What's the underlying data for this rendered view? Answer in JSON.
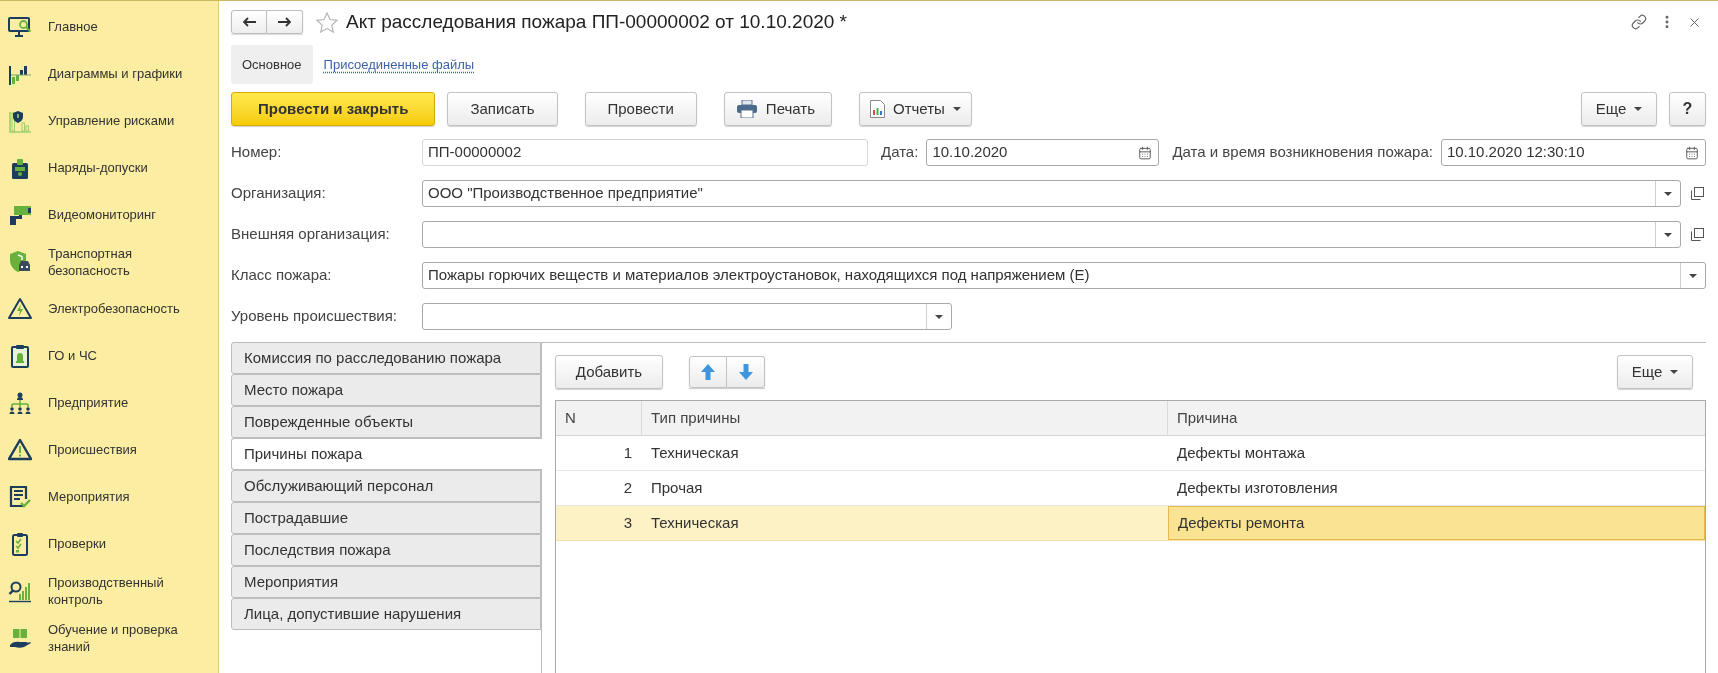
{
  "sidebar": {
    "items": [
      {
        "label": "Главное"
      },
      {
        "label": "Диаграммы и графики"
      },
      {
        "label": "Управление рисками"
      },
      {
        "label": "Наряды-допуски"
      },
      {
        "label": "Видеомониторинг"
      },
      {
        "label": "Транспортная безопасность"
      },
      {
        "label": "Электробезопасность"
      },
      {
        "label": "ГО и ЧС"
      },
      {
        "label": "Предприятие"
      },
      {
        "label": "Происшествия"
      },
      {
        "label": "Мероприятия"
      },
      {
        "label": "Проверки"
      },
      {
        "label": "Производственный контроль"
      },
      {
        "label": "Обучение и проверка знаний"
      }
    ]
  },
  "window": {
    "title": "Акт расследования пожара ПП-00000002 от 10.10.2020 *",
    "favorite": false
  },
  "form_tabs": [
    {
      "label": "Основное",
      "selected": true
    },
    {
      "label": "Присоединенные файлы",
      "selected": false
    }
  ],
  "command_bar": {
    "buttons": [
      {
        "label": "Провести и закрыть",
        "kind": "primary"
      },
      {
        "label": "Записать",
        "kind": "plain"
      },
      {
        "label": "Провести",
        "kind": "plain"
      },
      {
        "label": "Печать",
        "kind": "print"
      },
      {
        "label": "Отчеты",
        "kind": "reports"
      }
    ],
    "more": "Еще",
    "help": "?"
  },
  "fields": {
    "number": {
      "label": "Номер:",
      "value": "ПП-00000002"
    },
    "date": {
      "label": "Дата:",
      "value": "10.10.2020"
    },
    "fire_datetime": {
      "label": "Дата и время возникновения пожара:",
      "value": "10.10.2020 12:30:10"
    },
    "organization": {
      "label": "Организация:",
      "value": "ООО \"Производственное предприятие\""
    },
    "external_organization": {
      "label": "Внешняя организация:"
    },
    "fire_class": {
      "label": "Класс пожара:",
      "value": "Пожары горючих веществ и материалов электроустановок, находящихся под напряжением (E)"
    },
    "incident_level": {
      "label": "Уровень происшествия:"
    }
  },
  "sections": [
    {
      "label": "Комиссия по расследованию пожара",
      "selected": false
    },
    {
      "label": "Место пожара",
      "selected": false
    },
    {
      "label": "Поврежденные объекты",
      "selected": false
    },
    {
      "label": "Причины пожара",
      "selected": true
    },
    {
      "label": "Обслуживающий персонал",
      "selected": false
    },
    {
      "label": "Пострадавшие",
      "selected": false
    },
    {
      "label": "Последствия пожара",
      "selected": false
    },
    {
      "label": "Мероприятия",
      "selected": false
    },
    {
      "label": "Лица, допустившие нарушения",
      "selected": false
    }
  ],
  "table_toolbar": {
    "add": "Добавить",
    "more": "Еще"
  },
  "table": {
    "columns": [
      "N",
      "Тип причины",
      "Причина"
    ],
    "rows": [
      {
        "selected": false,
        "cells": [
          {
            "text": "1",
            "focused": false
          },
          {
            "text": "Техническая",
            "focused": false
          },
          {
            "text": "Дефекты монтажа",
            "focused": false
          }
        ]
      },
      {
        "selected": false,
        "cells": [
          {
            "text": "2",
            "focused": false
          },
          {
            "text": "Прочая",
            "focused": false
          },
          {
            "text": "Дефекты изготовления",
            "focused": false
          }
        ]
      },
      {
        "selected": true,
        "cells": [
          {
            "text": "3",
            "focused": false
          },
          {
            "text": "Техническая",
            "focused": false
          },
          {
            "text": "Дефекты ремонта",
            "focused": true
          }
        ]
      }
    ]
  }
}
